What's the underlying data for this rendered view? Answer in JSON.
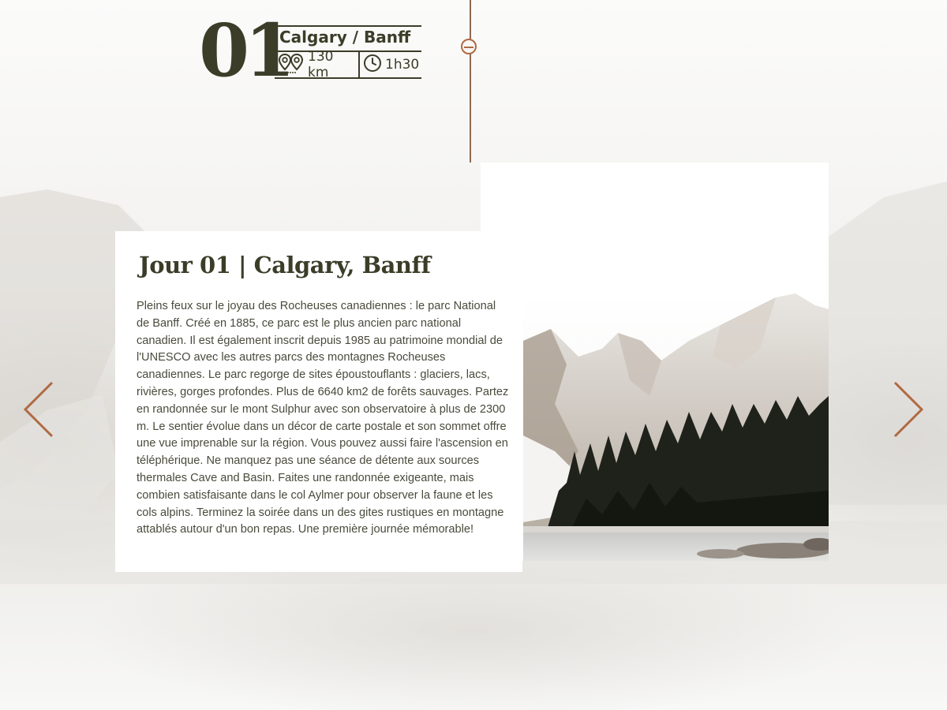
{
  "step": {
    "number": "01",
    "title": "Calgary / Banff",
    "distance": "130 km",
    "duration": "1h30"
  },
  "day": {
    "title": "Jour 01 | Calgary, Banff",
    "description": "Pleins feux sur le joyau des Rocheuses canadiennes : le parc National de Banff. Créé en 1885, ce parc est le plus ancien parc national canadien. Il est également inscrit depuis 1985 au patrimoine mondial de l'UNESCO avec les autres parcs des montagnes Rocheuses canadiennes. Le parc regorge de sites époustouflants : glaciers, lacs, rivières, gorges profondes. Plus de 6640 km2 de forêts sauvages. Partez en randonnée sur le mont Sulphur avec son observatoire à plus de 2300 m. Le sentier évolue dans un décor de carte postale et son sommet offre une vue imprenable sur la région. Vous pouvez aussi faire l'ascension en téléphérique. Ne manquez pas une séance de détente aux sources thermales Cave and Basin. Faites une randonnée exigeante, mais combien satisfaisante dans le col Aylmer pour observer la faune et les cols alpins. Terminez la soirée dans un des gites rustiques en montagne attablés autour d'un bon repas. Une première journée mémorable!"
  },
  "icons": {
    "distance": "map-pins-icon",
    "duration": "clock-icon",
    "prev": "chevron-left-icon",
    "next": "chevron-right-icon",
    "timeline": "timeline-marker-icon"
  },
  "colors": {
    "text_dark": "#3b3d28",
    "accent": "#b06a43",
    "body_text": "#4a4a3c"
  }
}
